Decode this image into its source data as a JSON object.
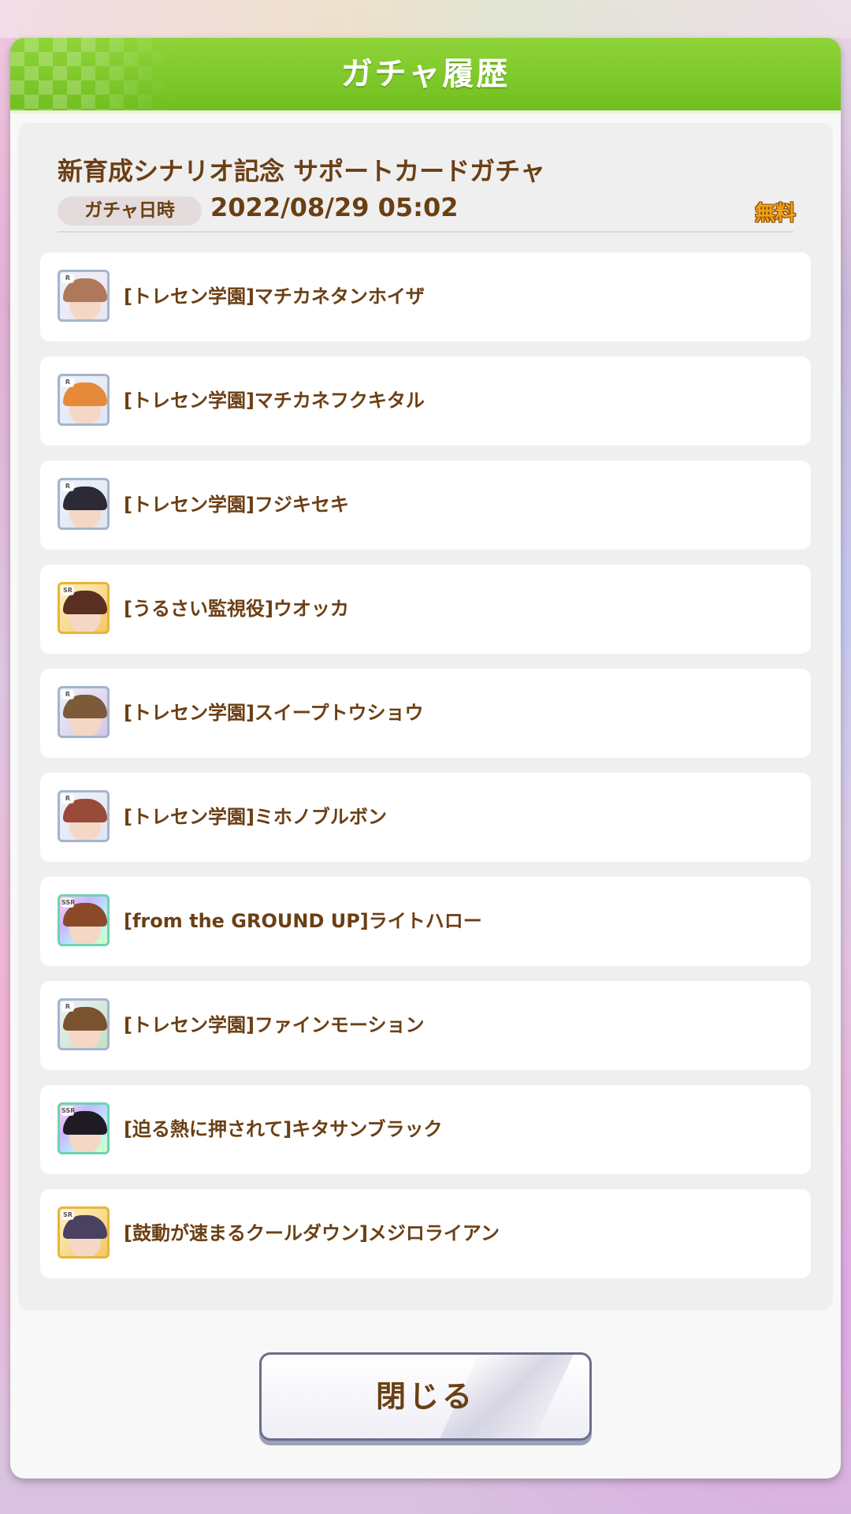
{
  "dialog": {
    "title": "ガチャ履歴",
    "gacha_name": "新育成シナリオ記念 サポートカードガチャ",
    "date_label": "ガチャ日時",
    "date_value": "2022/08/29 05:02",
    "cost_badge": "無料",
    "close_label": "閉じる"
  },
  "results": [
    {
      "label": "[トレセン学園]マチカネタンホイザ",
      "rarity": "R",
      "hair": "#b0785a",
      "accent": "#e9e4f4"
    },
    {
      "label": "[トレセン学園]マチカネフクキタル",
      "rarity": "R",
      "hair": "#e58a3a",
      "accent": "#dfe7f3"
    },
    {
      "label": "[トレセン学園]フジキセキ",
      "rarity": "R",
      "hair": "#2c2a36",
      "accent": "#dfe7f3"
    },
    {
      "label": "[うるさい監視役]ウオッカ",
      "rarity": "SR",
      "hair": "#5a2f22",
      "accent": "#f3d7a0"
    },
    {
      "label": "[トレセン学園]スイープトウショウ",
      "rarity": "R",
      "hair": "#7d5a3a",
      "accent": "#d4c6ea"
    },
    {
      "label": "[トレセン学園]ミホノブルボン",
      "rarity": "R",
      "hair": "#9a4a3a",
      "accent": "#dfe7f3"
    },
    {
      "label": "[from the GROUND UP]ライトハロー",
      "rarity": "SSR",
      "hair": "#8a4a2a",
      "accent": "#f0c4a8"
    },
    {
      "label": "[トレセン学園]ファインモーション",
      "rarity": "R",
      "hair": "#7a5230",
      "accent": "#bfe3c0"
    },
    {
      "label": "[迫る熱に押されて]キタサンブラック",
      "rarity": "SSR",
      "hair": "#1f1b24",
      "accent": "#f2b3c8"
    },
    {
      "label": "[鼓動が速まるクールダウン]メジロライアン",
      "rarity": "SR",
      "hair": "#4a4060",
      "accent": "#bfe0c9"
    }
  ]
}
